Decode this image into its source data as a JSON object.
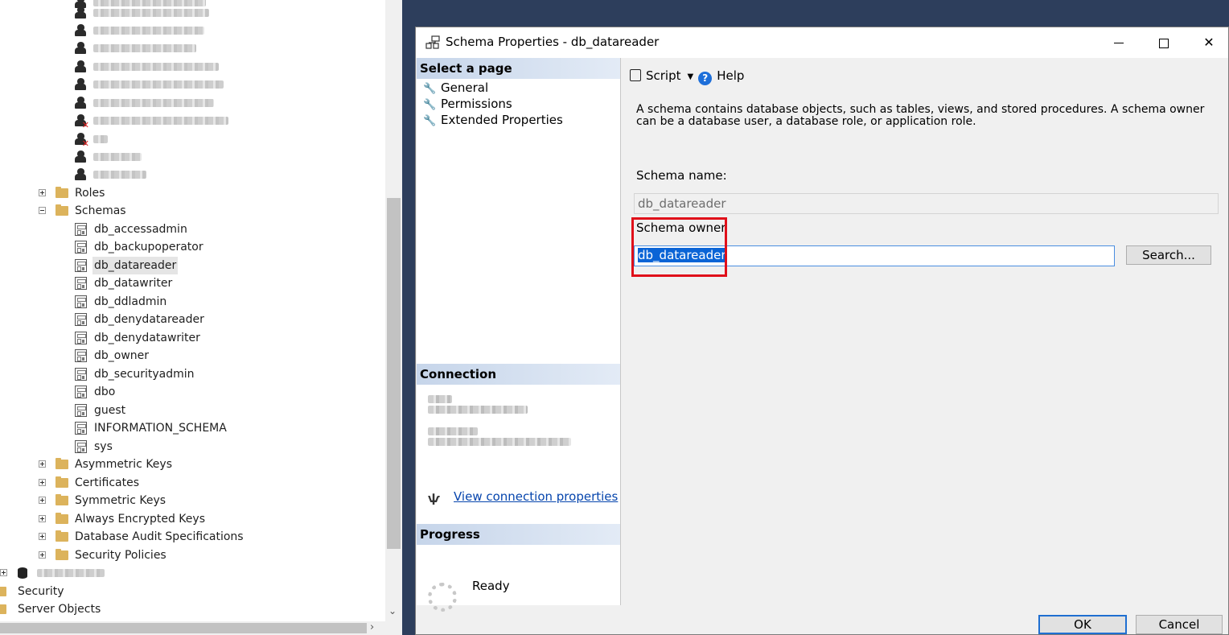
{
  "explorer": {
    "folders_top": [
      {
        "label": "Roles",
        "expanded": false
      },
      {
        "label": "Schemas",
        "expanded": true
      }
    ],
    "schemas": [
      "db_accessadmin",
      "db_backupoperator",
      "db_datareader",
      "db_datawriter",
      "db_ddladmin",
      "db_denydatareader",
      "db_denydatawriter",
      "db_owner",
      "db_securityadmin",
      "dbo",
      "guest",
      "INFORMATION_SCHEMA",
      "sys"
    ],
    "selected_schema": "db_datareader",
    "folders_bottom": [
      {
        "label": "Asymmetric Keys",
        "expanded": false
      },
      {
        "label": "Certificates",
        "expanded": false
      },
      {
        "label": "Symmetric Keys",
        "expanded": false
      },
      {
        "label": "Always Encrypted Keys",
        "expanded": false
      },
      {
        "label": "Database Audit Specifications",
        "expanded": false
      },
      {
        "label": "Security Policies",
        "expanded": false
      }
    ],
    "server_folders": [
      "Security",
      "Server Objects"
    ]
  },
  "dialog": {
    "title": "Schema Properties - db_datareader",
    "select_page_header": "Select a page",
    "pages": [
      "General",
      "Permissions",
      "Extended Properties"
    ],
    "connection_header": "Connection",
    "view_connection_link": "View connection properties",
    "progress_header": "Progress",
    "progress_status": "Ready",
    "toolbar": {
      "script_label": "Script",
      "help_label": "Help"
    },
    "description": "A schema contains database objects, such as tables, views, and stored procedures. A schema owner can be a database user, a database role, or application role.",
    "schema_name_label": "Schema name:",
    "schema_name_value": "db_datareader",
    "schema_owner_label": "Schema owner",
    "schema_owner_value": "db_datareader",
    "search_button": "Search...",
    "ok_button": "OK",
    "cancel_button": "Cancel"
  },
  "colors": {
    "accent": "#0a64d6",
    "highlight_box": "#e0101a",
    "section_header": "#c6d5ea",
    "backdrop": "#2d3e5c"
  }
}
